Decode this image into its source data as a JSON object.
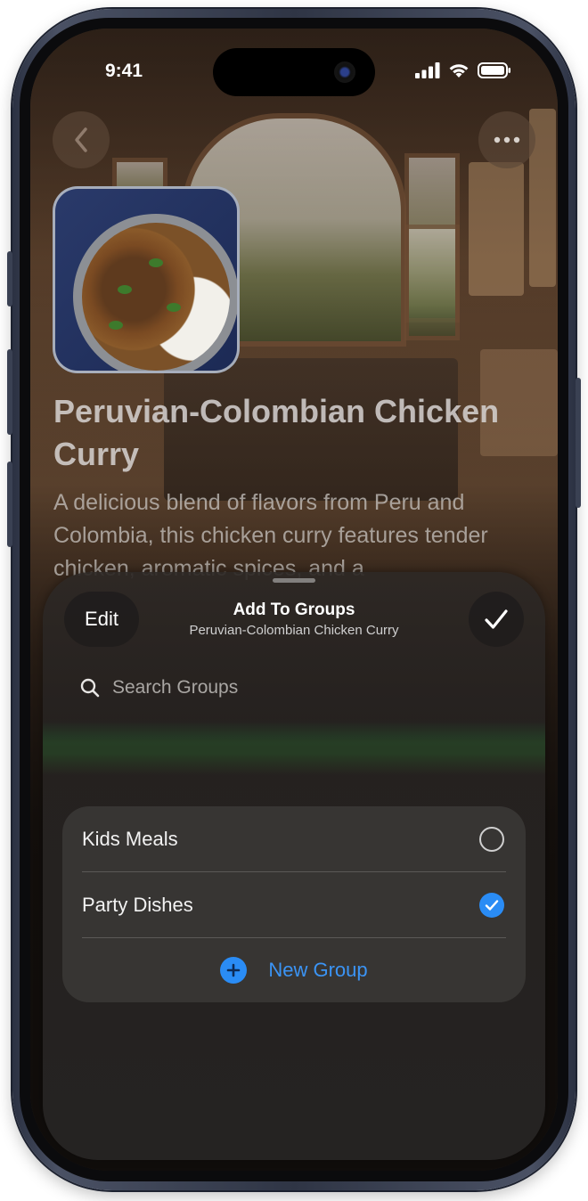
{
  "status_bar": {
    "time": "9:41"
  },
  "recipe": {
    "title": "Peruvian-Colombian Chicken Curry",
    "description": "A delicious blend of flavors from Peru and Colombia, this chicken curry features tender chicken, aromatic spices, and a"
  },
  "sheet": {
    "edit_label": "Edit",
    "title": "Add To Groups",
    "subtitle": "Peruvian-Colombian Chicken Curry",
    "search_placeholder": "Search Groups",
    "groups": [
      {
        "label": "Kids Meals",
        "selected": false
      },
      {
        "label": "Party Dishes",
        "selected": true
      }
    ],
    "new_group_label": "New Group"
  },
  "colors": {
    "accent": "#2a8cf5",
    "link": "#3b94f5"
  }
}
